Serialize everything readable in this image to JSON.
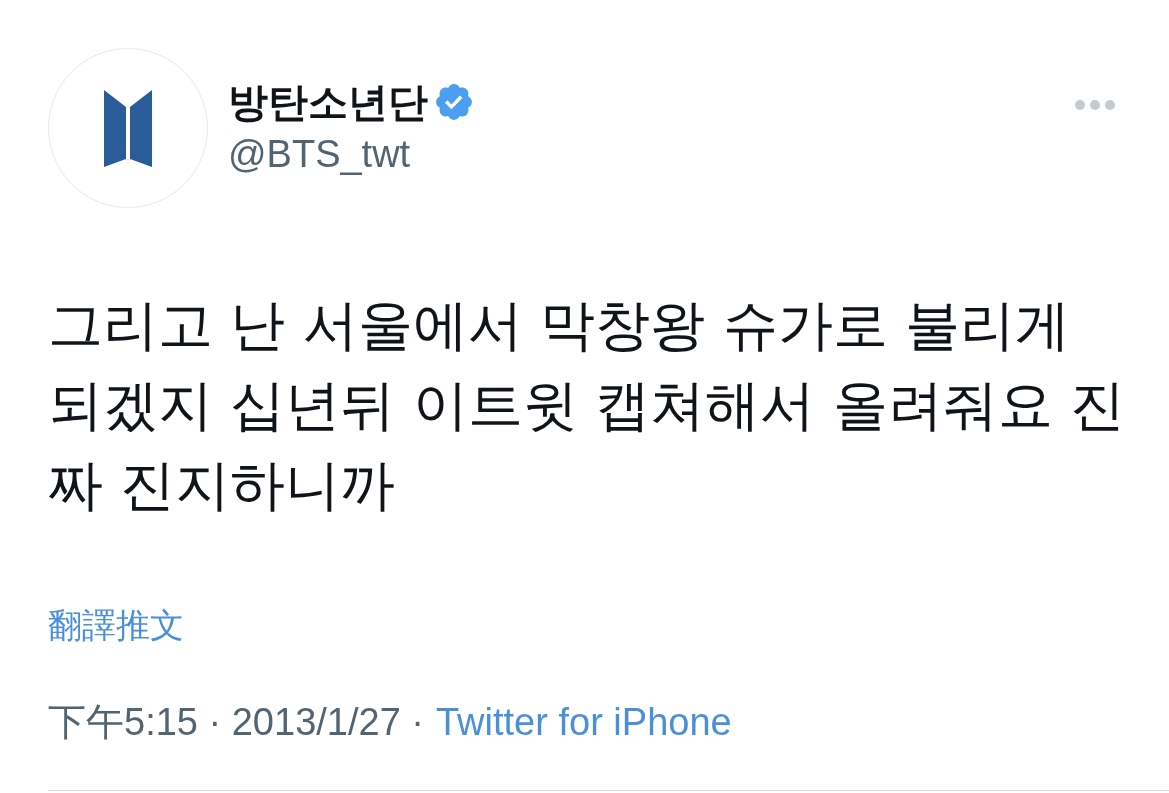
{
  "tweet": {
    "author": {
      "name": "방탄소년단",
      "verified": true,
      "handle": "@BTS_twt"
    },
    "text": "그리고 난 서울에서 막창왕 슈가로 불리게 되겠지 십년뒤 이트윗 캡쳐해서 올려줘요 진짜 진지하니까",
    "translate_link": "翻譯推文",
    "meta": {
      "timestamp": "下午5:15 · 2013/1/27 ·",
      "source": "Twitter for iPhone"
    }
  }
}
